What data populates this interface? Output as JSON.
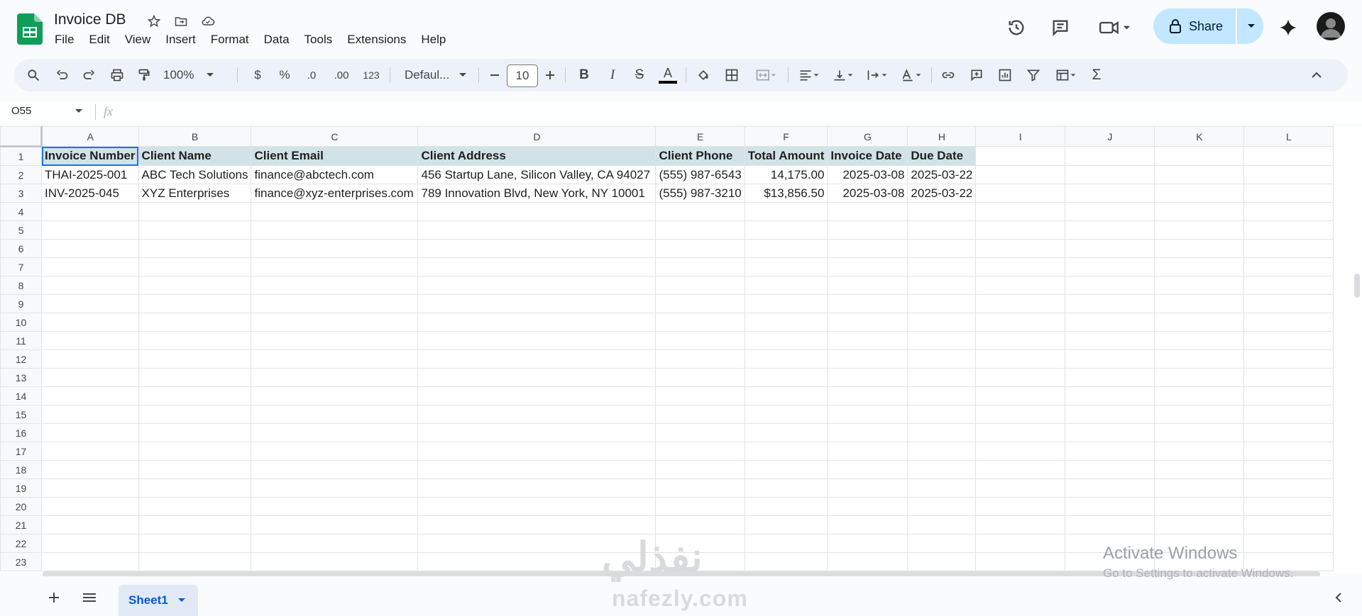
{
  "doc": {
    "title": "Invoice DB"
  },
  "menu": [
    "File",
    "Edit",
    "View",
    "Insert",
    "Format",
    "Data",
    "Tools",
    "Extensions",
    "Help"
  ],
  "share": {
    "label": "Share"
  },
  "toolbar": {
    "zoom": "100%",
    "currency": "$",
    "percent": "%",
    "dec_decrease": ".0",
    "dec_increase": ".00",
    "format_123": "123",
    "font": "Defaul...",
    "font_size": "10"
  },
  "formula": {
    "namebox": "O55",
    "fx": "fx"
  },
  "grid": {
    "columns": [
      "A",
      "B",
      "C",
      "D",
      "E",
      "F",
      "G",
      "H",
      "I",
      "J",
      "K",
      "L"
    ],
    "row_numbers": [
      "1",
      "2",
      "3",
      "4",
      "5",
      "6",
      "7",
      "8",
      "9",
      "10",
      "11",
      "12",
      "13",
      "14",
      "15",
      "16",
      "17",
      "18",
      "19",
      "20",
      "21",
      "22",
      "23"
    ],
    "rows": [
      [
        "Invoice Number",
        "Client Name",
        "Client Email",
        "Client Address",
        "Client Phone",
        "Total Amount",
        "Invoice Date",
        "Due Date",
        "",
        "",
        "",
        ""
      ],
      [
        "THAI-2025-001",
        "ABC Tech Solutions",
        "finance@abctech.com",
        "456 Startup Lane, Silicon Valley, CA 94027",
        "(555) 987-6543",
        "14,175.00",
        "2025-03-08",
        "2025-03-22",
        "",
        "",
        "",
        ""
      ],
      [
        "INV-2025-045",
        "XYZ Enterprises",
        "finance@xyz-enterprises.com",
        "789 Innovation Blvd, New York, NY 10001",
        "(555) 987-3210",
        "$13,856.50",
        "2025-03-08",
        "2025-03-22",
        "",
        "",
        "",
        ""
      ]
    ]
  },
  "sheets": {
    "active": "Sheet1"
  },
  "overlay": {
    "activate_title": "Activate Windows",
    "activate_sub": "Go to Settings to activate Windows.",
    "brand_ar": "نفذلي",
    "brand_en": "nafezly.com"
  }
}
